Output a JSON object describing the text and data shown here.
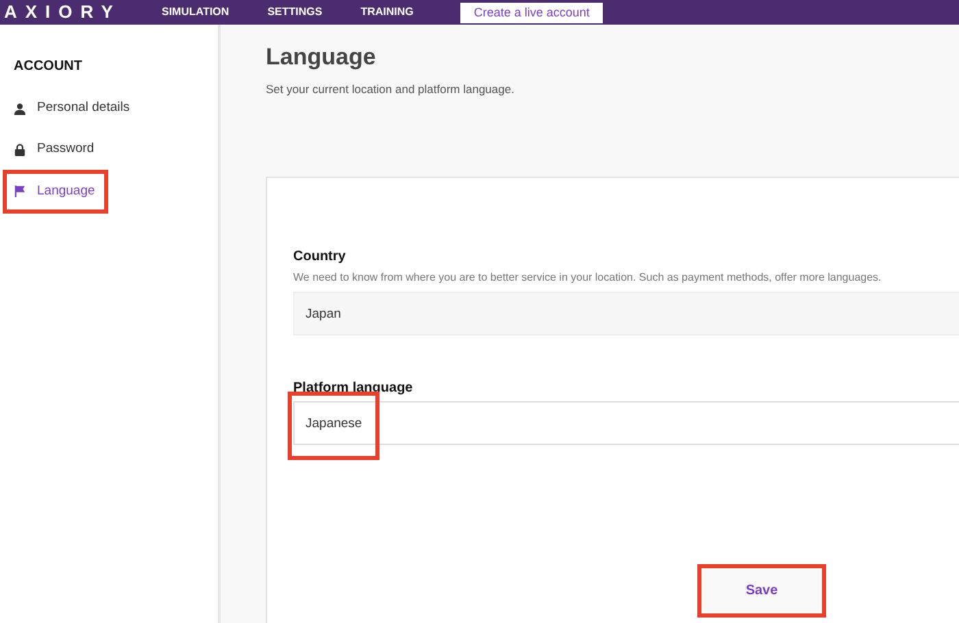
{
  "navbar": {
    "logo": "AXIORY",
    "links": [
      {
        "label": "SIMULATION"
      },
      {
        "label": "SETTINGS"
      },
      {
        "label": "TRAINING"
      }
    ],
    "cta": "Create a live account"
  },
  "sidebar": {
    "heading": "ACCOUNT",
    "items": [
      {
        "label": "Personal details",
        "kind": "person",
        "selected": false,
        "highlighted": false
      },
      {
        "label": "Password",
        "kind": "lock",
        "selected": false,
        "highlighted": false
      },
      {
        "label": "Language",
        "kind": "flag",
        "selected": true,
        "highlighted": true
      }
    ]
  },
  "page": {
    "title": "Language",
    "subtitle": "Set your current location and platform language."
  },
  "form": {
    "fields": [
      {
        "label": "Country",
        "hint": "We need to know from where you are to better service in your location. Such as payment methods, offer more languages.",
        "value": "Japan",
        "disabled": true,
        "highlighted": false
      },
      {
        "label": "Platform language",
        "value": "Japanese",
        "disabled": false,
        "highlighted": true
      }
    ],
    "save": {
      "label": "Save",
      "highlighted": true
    }
  }
}
